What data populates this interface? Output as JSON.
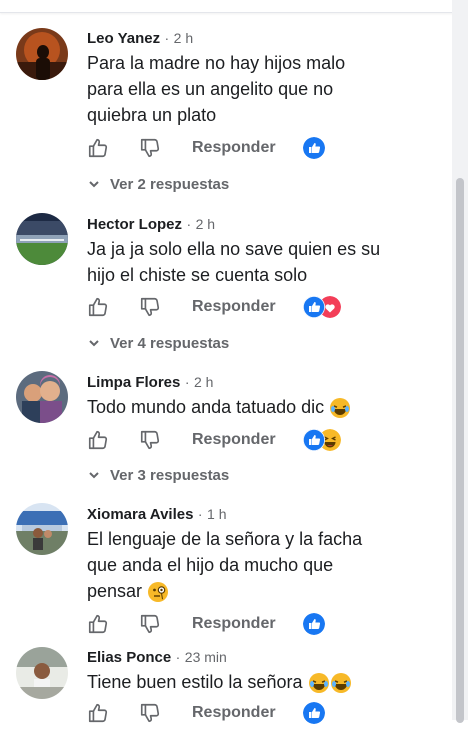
{
  "comments": [
    {
      "author": "Leo Yanez",
      "time": "2 h",
      "text_lines": [
        "Para la madre no hay hijos malo",
        "para ella es un angelito que no",
        "quiebra un plato"
      ],
      "reply_label": "Responder",
      "replies_label": "Ver 2 respuestas",
      "reactions": [
        "like"
      ]
    },
    {
      "author": "Hector Lopez",
      "time": "2 h",
      "text_lines": [
        "Ja ja ja solo ella no save quien es su",
        "hijo el chiste se cuenta solo"
      ],
      "reply_label": "Responder",
      "replies_label": "Ver 4 respuestas",
      "reactions": [
        "like",
        "love"
      ]
    },
    {
      "author": "Limpa Flores",
      "time": "2 h",
      "text_lines": [
        "Todo mundo anda tatuado dic"
      ],
      "reply_label": "Responder",
      "replies_label": "Ver 3 respuestas",
      "reactions": [
        "like",
        "haha"
      ]
    },
    {
      "author": "Xiomara Aviles",
      "time": "1 h",
      "text_lines": [
        "El lenguaje de la señora y la facha",
        "que anda el hijo da mucho que",
        "pensar"
      ],
      "reply_label": "Responder",
      "reactions": [
        "like"
      ]
    },
    {
      "author": "Elias Ponce",
      "time": "23 min",
      "text_lines": [
        "Tiene buen estilo la señora"
      ],
      "reply_label": "Responder",
      "reactions": [
        "like"
      ]
    }
  ],
  "separator": "·",
  "icons": {
    "like_action": "thumbs-up-outline-icon",
    "dislike_action": "thumbs-down-outline-icon",
    "reply_chevron": "chevron-down-icon"
  },
  "colors": {
    "like_blue": "#1877f2",
    "love_red": "#f33e58",
    "haha_yellow": "#f7b928",
    "secondary_text": "#65676b"
  }
}
